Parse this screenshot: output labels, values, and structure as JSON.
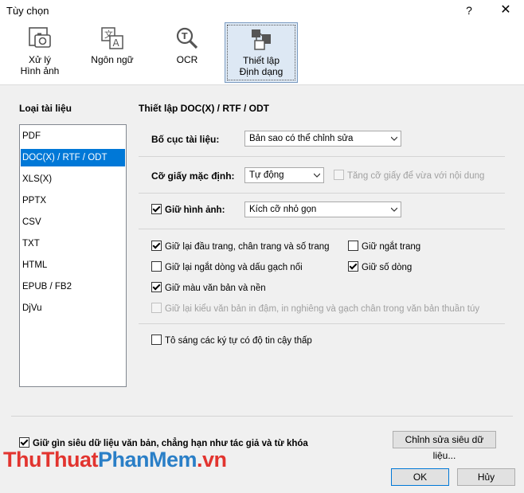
{
  "window": {
    "title": "Tùy chọn",
    "help": "?",
    "close": "✕"
  },
  "toolbar": {
    "items": [
      {
        "label1": "Xử lý",
        "label2": "Hình ảnh"
      },
      {
        "label1": "Ngôn ngữ",
        "label2": ""
      },
      {
        "label1": "OCR",
        "label2": ""
      },
      {
        "label1": "Thiết lập",
        "label2": "Định dạng"
      }
    ]
  },
  "left": {
    "heading": "Loại tài liệu",
    "items": [
      "PDF",
      "DOC(X) / RTF / ODT",
      "XLS(X)",
      "PPTX",
      "CSV",
      "TXT",
      "HTML",
      "EPUB / FB2",
      "DjVu"
    ],
    "selected": "DOC(X) / RTF / ODT"
  },
  "right": {
    "heading": "Thiết lập DOC(X) / RTF / ODT",
    "layout_label": "Bố cục tài liệu:",
    "layout_value": "Bản sao có thể chỉnh sửa",
    "paper_label": "Cỡ giấy mặc định:",
    "paper_value": "Tự động",
    "paper_fit": "Tăng cỡ giấy để vừa với nội dung",
    "keep_images": "Giữ hình ảnh:",
    "image_value": "Kích cỡ nhỏ gọn",
    "opt_headers": "Giữ lại đầu trang, chân trang và số trang",
    "opt_pagebreak": "Giữ ngắt trang",
    "opt_linebreak": "Giữ lại ngắt dòng và dấu gạch nối",
    "opt_linenum": "Giữ số dòng",
    "opt_color": "Giữ màu văn bản và nền",
    "opt_style": "Giữ lại kiểu văn bản in đậm, in nghiêng và gạch chân trong văn bản thuần túy",
    "opt_highlight": "Tô sáng các ký tự có độ tin cậy thấp"
  },
  "bottom": {
    "metadata": "Giữ gìn siêu dữ liệu văn bản, chẳng hạn như tác giả và từ khóa",
    "edit_meta": "Chỉnh sửa siêu dữ liệu...",
    "ok": "OK",
    "cancel": "Hủy"
  },
  "watermark": {
    "part1": "ThuThuat",
    "part2": "PhanMem",
    "part3": ".vn"
  }
}
